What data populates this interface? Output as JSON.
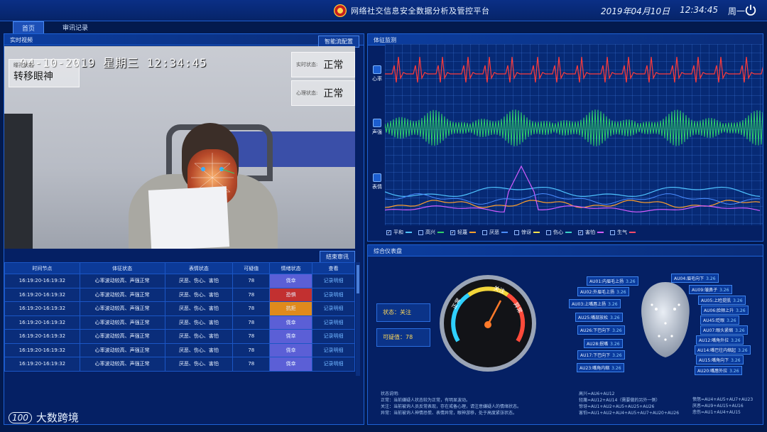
{
  "header": {
    "title": "网络社交信息安全数据分析及管控平台",
    "date": "2019年04月10日",
    "time": "12:34:45",
    "weekday": "周一"
  },
  "tabs": [
    {
      "label": "首页",
      "active": true
    },
    {
      "label": "审讯记录",
      "active": false
    }
  ],
  "video_panel": {
    "title": "实时视频",
    "config_button": "智能流配置",
    "timestamp": "04-10-2019 星期三 12:34:45",
    "eye_small": "瞳孔状态",
    "eye_value": "转移眼神",
    "realtime_label": "实时状态:",
    "realtime_value": "正常",
    "psych_label": "心理状态:",
    "psych_value": "正常",
    "end_button": "结束审讯"
  },
  "table": {
    "headers": [
      "时间节点",
      "体征状态",
      "表情状态",
      "可疑值",
      "情绪状态",
      "查看"
    ],
    "rows": [
      {
        "time": "16:19:20-16:19:32",
        "vital": "心率波动较高、声强正常",
        "expr": "厌恶、伤心、害怕",
        "score": "78",
        "emotion": "侥幸",
        "emo_color": "blue",
        "link": "记录明细"
      },
      {
        "time": "16:19:20-16:19:32",
        "vital": "心率波动较高、声强正常",
        "expr": "厌恶、伤心、害怕",
        "score": "78",
        "emotion": "恐惧",
        "emo_color": "red",
        "link": "记录明细"
      },
      {
        "time": "16:19:20-16:19:32",
        "vital": "心率波动较高、声强正常",
        "expr": "厌恶、伤心、害怕",
        "score": "78",
        "emotion": "抗拒",
        "emo_color": "orange",
        "link": "记录明细"
      },
      {
        "time": "16:19:20-16:19:32",
        "vital": "心率波动较高、声强正常",
        "expr": "厌恶、伤心、害怕",
        "score": "78",
        "emotion": "侥幸",
        "emo_color": "blue",
        "link": "记录明细"
      },
      {
        "time": "16:19:20-16:19:32",
        "vital": "心率波动较高、声强正常",
        "expr": "厌恶、伤心、害怕",
        "score": "78",
        "emotion": "侥幸",
        "emo_color": "blue",
        "link": "记录明细"
      },
      {
        "time": "16:19:20-16:19:32",
        "vital": "心率波动较高、声强正常",
        "expr": "厌恶、伤心、害怕",
        "score": "78",
        "emotion": "侥幸",
        "emo_color": "blue",
        "link": "记录明细"
      },
      {
        "time": "16:19:20-16:19:32",
        "vital": "心率波动较高、声强正常",
        "expr": "厌恶、伤心、害怕",
        "score": "78",
        "emotion": "侥幸",
        "emo_color": "blue",
        "link": "记录明细"
      }
    ]
  },
  "vitals_panel": {
    "title": "体征监测",
    "heart_label": "心率",
    "voice_label": "声强",
    "expr_label": "表情",
    "colors": {
      "heart": "#ff3b3b",
      "voice": "#2fd06a",
      "grid_bg": "#072a75"
    },
    "legend": [
      {
        "label": "平和",
        "checked": true,
        "color": "#4fc3ff"
      },
      {
        "label": "高兴",
        "checked": false,
        "color": "#2fd06a"
      },
      {
        "label": "轻蔑",
        "checked": true,
        "color": "#ff9f2b"
      },
      {
        "label": "厌恶",
        "checked": false,
        "color": "#4a8cff"
      },
      {
        "label": "惊讶",
        "checked": false,
        "color": "#ffe24a"
      },
      {
        "label": "伤心",
        "checked": false,
        "color": "#3ad1c8"
      },
      {
        "label": "害怕",
        "checked": true,
        "color": "#d35cff"
      },
      {
        "label": "生气",
        "checked": false,
        "color": "#ff4a6a"
      }
    ]
  },
  "dashboard_panel": {
    "title": "综合仪表盘",
    "status": "状态：关注",
    "suspicion": "可疑值：78",
    "gauge_labels": [
      "正常",
      "关注",
      "异常"
    ],
    "au_left": [
      {
        "label": "AU01:内眉毛上扬",
        "value": "3.26"
      },
      {
        "label": "AU02:外眉毛上扬",
        "value": "3.26"
      },
      {
        "label": "AU03:上嘴唇上扬",
        "value": "3.26"
      },
      {
        "label": "AU25:嘴部放松",
        "value": "3.26"
      },
      {
        "label": "AU26:下巴向下",
        "value": "3.26"
      },
      {
        "label": "AU28:抿嘴",
        "value": "3.26"
      },
      {
        "label": "AU17:下巴向下",
        "value": "3.26"
      },
      {
        "label": "AU23:嘴角内缩",
        "value": "3.26"
      }
    ],
    "au_right": [
      {
        "label": "AU04:眉毛向下",
        "value": "3.26"
      },
      {
        "label": "AU09:皱鼻子",
        "value": "3.26"
      },
      {
        "label": "AU05:上睑提肌",
        "value": "3.26"
      },
      {
        "label": "AU06:脸颊上升",
        "value": "3.26"
      },
      {
        "label": "AU45:眨眼",
        "value": "3.26"
      },
      {
        "label": "AU07:眼头紧缩",
        "value": "3.26"
      },
      {
        "label": "AU12:嘴角外拉",
        "value": "3.26"
      },
      {
        "label": "AU14:嘴巴往内缩起",
        "value": "3.26"
      },
      {
        "label": "AU15:嘴角向下",
        "value": "3.26"
      },
      {
        "label": "AU20:嘴唇外拉",
        "value": "3.26"
      }
    ],
    "notes_title": "状态说明:",
    "notes": [
      "正常：当前嫌疑人状态较为正常，有明显波动。",
      "关注：当前被询人员反常表现，存在戒备心理，请注意嫌疑人的情绪状态。",
      "异常：当前被询人神情恐慌、表情异常，眼神游移，处于高度紧张状态。"
    ],
    "formulas_mid": [
      "高兴=AU6+AU12",
      "轻蔑=AU12+AU14（需要做的另外一侧）",
      "惊讶=AU1+AU2+AU5+AU25+AU26",
      "害怕=AU1+AU2+AU4+AU5+AU7+AU20+AU26"
    ],
    "formulas_right": [
      "愤怒=AU4+AU5+AU7+AU23",
      "厌恶=AU9+AU15+AU16",
      "悲伤=AU1+AU4+AU15"
    ]
  },
  "watermark": {
    "logo": "100",
    "text": "大数跨境"
  }
}
